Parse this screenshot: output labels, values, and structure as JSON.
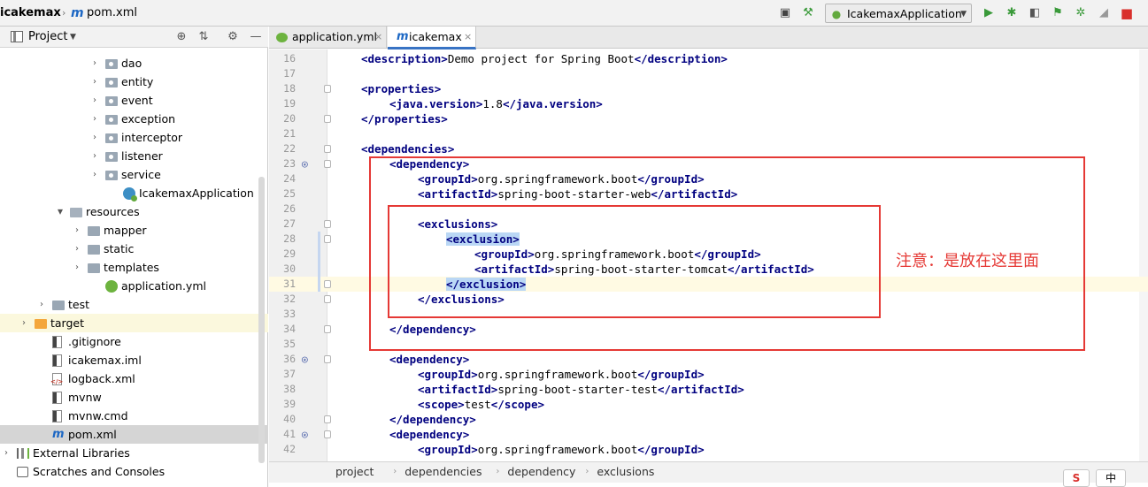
{
  "navbar": {
    "project": "icakemax",
    "file": "pom.xml",
    "run_config": "IcakemaxApplication"
  },
  "toolbar_icons": [
    "layout-icon",
    "build-icon",
    "run-icon",
    "debug-icon",
    "coverage-icon",
    "profile-icon",
    "attach-icon",
    "bug-icon",
    "stop-icon"
  ],
  "project_panel": {
    "title": "Project",
    "tree": [
      {
        "label": "dao",
        "depth": 5,
        "arrow": "›",
        "icon": "folder-dot"
      },
      {
        "label": "entity",
        "depth": 5,
        "arrow": "›",
        "icon": "folder-dot"
      },
      {
        "label": "event",
        "depth": 5,
        "arrow": "›",
        "icon": "folder-dot"
      },
      {
        "label": "exception",
        "depth": 5,
        "arrow": "›",
        "icon": "folder-dot"
      },
      {
        "label": "interceptor",
        "depth": 5,
        "arrow": "›",
        "icon": "folder-dot"
      },
      {
        "label": "listener",
        "depth": 5,
        "arrow": "›",
        "icon": "folder-dot"
      },
      {
        "label": "service",
        "depth": 5,
        "arrow": "›",
        "icon": "folder-dot"
      },
      {
        "label": "IcakemaxApplication",
        "depth": 6,
        "arrow": "",
        "icon": "class"
      },
      {
        "label": "resources",
        "depth": 3,
        "arrow": "⌄",
        "icon": "folder-res"
      },
      {
        "label": "mapper",
        "depth": 4,
        "arrow": "›",
        "icon": "folder"
      },
      {
        "label": "static",
        "depth": 4,
        "arrow": "›",
        "icon": "folder"
      },
      {
        "label": "templates",
        "depth": 4,
        "arrow": "›",
        "icon": "folder"
      },
      {
        "label": "application.yml",
        "depth": 5,
        "arrow": "",
        "icon": "spring"
      },
      {
        "label": "test",
        "depth": 2,
        "arrow": "›",
        "icon": "folder"
      },
      {
        "label": "target",
        "depth": 1,
        "arrow": "›",
        "icon": "folder-orange"
      },
      {
        "label": ".gitignore",
        "depth": 2,
        "arrow": "",
        "icon": "file-dark"
      },
      {
        "label": "icakemax.iml",
        "depth": 2,
        "arrow": "",
        "icon": "file-dark"
      },
      {
        "label": "logback.xml",
        "depth": 2,
        "arrow": "",
        "icon": "file-xml"
      },
      {
        "label": "mvnw",
        "depth": 2,
        "arrow": "",
        "icon": "file-dark"
      },
      {
        "label": "mvnw.cmd",
        "depth": 2,
        "arrow": "",
        "icon": "file-dark"
      },
      {
        "label": "pom.xml",
        "depth": 2,
        "arrow": "",
        "icon": "m"
      },
      {
        "label": "External Libraries",
        "depth": 0,
        "arrow": "›",
        "icon": "lib"
      },
      {
        "label": "Scratches and Consoles",
        "depth": 0,
        "arrow": "",
        "icon": "scratch"
      }
    ]
  },
  "tabs": [
    {
      "label": "application.yml",
      "icon": "spring",
      "active": false
    },
    {
      "label": "icakemax",
      "icon": "m",
      "active": true
    }
  ],
  "editor": {
    "lines": [
      {
        "n": "16",
        "indent": 0,
        "parts": [
          [
            "t",
            "<description>"
          ],
          [
            "x",
            "Demo project for Spring Boot"
          ],
          [
            "t",
            "</description>"
          ]
        ]
      },
      {
        "n": "17",
        "indent": 0,
        "parts": []
      },
      {
        "n": "18",
        "indent": 0,
        "fold": true,
        "parts": [
          [
            "t",
            "<properties>"
          ]
        ]
      },
      {
        "n": "19",
        "indent": 1,
        "parts": [
          [
            "t",
            "<java.version>"
          ],
          [
            "x",
            "1.8"
          ],
          [
            "t",
            "</java.version>"
          ]
        ]
      },
      {
        "n": "20",
        "indent": 0,
        "fold": true,
        "parts": [
          [
            "t",
            "</properties>"
          ]
        ]
      },
      {
        "n": "21",
        "indent": 0,
        "parts": []
      },
      {
        "n": "22",
        "indent": 0,
        "fold": true,
        "parts": [
          [
            "t",
            "<dependencies>"
          ]
        ]
      },
      {
        "n": "23",
        "indent": 1,
        "fold": true,
        "gicon": true,
        "parts": [
          [
            "t",
            "<dependency>"
          ]
        ]
      },
      {
        "n": "24",
        "indent": 2,
        "parts": [
          [
            "t",
            "<groupId>"
          ],
          [
            "x",
            "org.springframework.boot"
          ],
          [
            "t",
            "</groupId>"
          ]
        ]
      },
      {
        "n": "25",
        "indent": 2,
        "parts": [
          [
            "t",
            "<artifactId>"
          ],
          [
            "x",
            "spring-boot-starter-web"
          ],
          [
            "t",
            "</artifactId>"
          ]
        ]
      },
      {
        "n": "26",
        "indent": 0,
        "parts": []
      },
      {
        "n": "27",
        "indent": 2,
        "fold": true,
        "parts": [
          [
            "t",
            "<exclusions>"
          ]
        ]
      },
      {
        "n": "28",
        "indent": 3,
        "fold": true,
        "mod": true,
        "parts": [
          [
            "h",
            "<exclusion>"
          ]
        ]
      },
      {
        "n": "29",
        "indent": 4,
        "mod": true,
        "parts": [
          [
            "t",
            "<groupId>"
          ],
          [
            "x",
            "org.springframework.boot"
          ],
          [
            "t",
            "</groupId>"
          ]
        ]
      },
      {
        "n": "30",
        "indent": 4,
        "mod": true,
        "parts": [
          [
            "t",
            "<artifactId>"
          ],
          [
            "x",
            "spring-boot-starter-tomcat"
          ],
          [
            "t",
            "</artifactId>"
          ]
        ]
      },
      {
        "n": "31",
        "indent": 3,
        "fold": true,
        "mod": true,
        "current": true,
        "parts": [
          [
            "h",
            "</exclusion>"
          ]
        ]
      },
      {
        "n": "32",
        "indent": 2,
        "fold": true,
        "parts": [
          [
            "t",
            "</exclusions>"
          ]
        ]
      },
      {
        "n": "33",
        "indent": 0,
        "parts": []
      },
      {
        "n": "34",
        "indent": 1,
        "fold": true,
        "parts": [
          [
            "t",
            "</dependency>"
          ]
        ]
      },
      {
        "n": "35",
        "indent": 0,
        "parts": []
      },
      {
        "n": "36",
        "indent": 1,
        "fold": true,
        "gicon": true,
        "parts": [
          [
            "t",
            "<dependency>"
          ]
        ]
      },
      {
        "n": "37",
        "indent": 2,
        "parts": [
          [
            "t",
            "<groupId>"
          ],
          [
            "x",
            "org.springframework.boot"
          ],
          [
            "t",
            "</groupId>"
          ]
        ]
      },
      {
        "n": "38",
        "indent": 2,
        "parts": [
          [
            "t",
            "<artifactId>"
          ],
          [
            "x",
            "spring-boot-starter-test"
          ],
          [
            "t",
            "</artifactId>"
          ]
        ]
      },
      {
        "n": "39",
        "indent": 2,
        "parts": [
          [
            "t",
            "<scope>"
          ],
          [
            "x",
            "test"
          ],
          [
            "t",
            "</scope>"
          ]
        ]
      },
      {
        "n": "40",
        "indent": 1,
        "fold": true,
        "parts": [
          [
            "t",
            "</dependency>"
          ]
        ]
      },
      {
        "n": "41",
        "indent": 1,
        "fold": true,
        "gicon": true,
        "parts": [
          [
            "t",
            "<dependency>"
          ]
        ]
      },
      {
        "n": "42",
        "indent": 2,
        "parts": [
          [
            "t",
            "<groupId>"
          ],
          [
            "x",
            "org.springframework.boot"
          ],
          [
            "t",
            "</groupId>"
          ]
        ]
      }
    ],
    "annotation": "注意：是放在这里面"
  },
  "browser_icons": [
    {
      "name": "chrome-icon",
      "color": "#e8453c"
    },
    {
      "name": "firefox-icon",
      "color": "#e66000"
    },
    {
      "name": "safari-icon",
      "color": "#1e88e5"
    },
    {
      "name": "opera-icon",
      "color": "#cc0f16"
    },
    {
      "name": "ie-icon",
      "color": "#4fc3f7"
    },
    {
      "name": "edge-icon",
      "color": "#1976d2"
    }
  ],
  "breadcrumb": [
    "project",
    "dependencies",
    "dependency",
    "exclusions"
  ],
  "ime": {
    "label": "中"
  },
  "colors": {
    "annotation_red": "#e53935",
    "tag_blue": "#000080",
    "selection": "#bad7f5"
  }
}
